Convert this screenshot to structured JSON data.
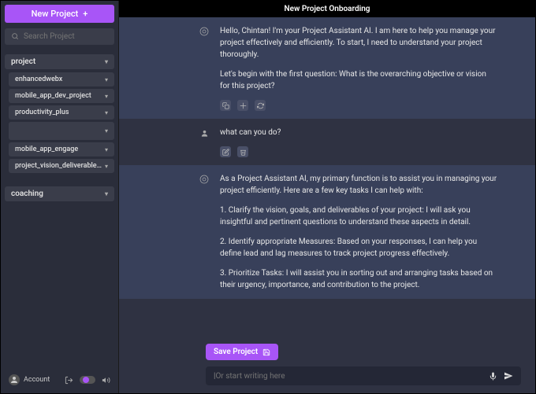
{
  "sidebar": {
    "new_project_label": "New Project",
    "search_placeholder": "Search Project",
    "category1": {
      "label": "project",
      "items": [
        {
          "label": "enhancedwebx"
        },
        {
          "label": "mobile_app_dev_project"
        },
        {
          "label": "productivity_plus"
        },
        {
          "label": ""
        },
        {
          "label": "mobile_app_engage"
        },
        {
          "label": "project_vision_deliverables_go..."
        }
      ]
    },
    "category2": {
      "label": "coaching"
    },
    "account_label": "Account"
  },
  "header": {
    "title": "New Project Onboarding"
  },
  "messages": {
    "m1": {
      "p1": "Hello, Chintan! I'm your Project Assistant AI. I am here to help you manage your project effectively and efficiently. To start, I need to understand your project thoroughly.",
      "p2": "Let's begin with the first question: What is the overarching objective or vision for this project?"
    },
    "m2": {
      "p1": "what can you do?"
    },
    "m3": {
      "p1": "As a Project Assistant AI, my primary function is to assist you in managing your project efficiently. Here are a few key tasks I can help with:",
      "p2": "1. Clarify the vision, goals, and deliverables of your project: I will ask you insightful and pertinent questions to understand these aspects in detail.",
      "p3": "2. Identify appropriate Measures: Based on your responses, I can help you define lead and lag measures to track project progress effectively.",
      "p4": "3. Prioritize Tasks: I will assist you in sorting out and arranging tasks based on their urgency, importance, and contribution to the project."
    }
  },
  "actions": {
    "save_project": "Save Project"
  },
  "input": {
    "placeholder": "Or start writing here"
  }
}
